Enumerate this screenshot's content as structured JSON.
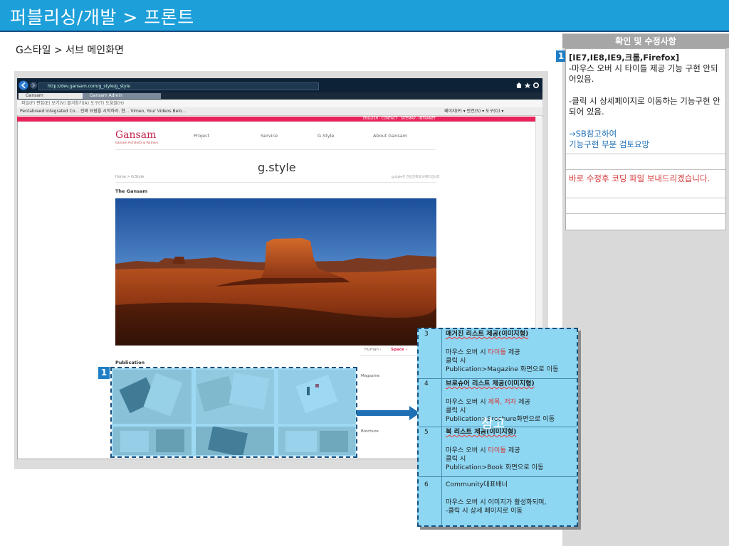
{
  "header": {
    "title": "퍼블리싱/개발 > 프론트"
  },
  "subtitle": "G스타일 > 서브 메인화면",
  "review_panel": {
    "heading": "확인 및 수정사항",
    "badge": "1",
    "browsers": "[IE7,IE8,IE9,크롬,Firefox]",
    "note1": "-마우스 오버 시 타이틀 제공 기능 구현 안되어있음.",
    "note2": "-클릭 시 상세페이지로 이동하는 기능구현 안되어 있음.",
    "note3a": "→SB참고하여",
    "note3b": "기능구현 부분 검토요망",
    "reply": "바로 수정후 코딩 파일 보내드리겠습니다."
  },
  "browser": {
    "address": "http://dev.gansam.com/g_style/g_style",
    "tab1": "Gansam",
    "tab2": "Gansam Admin",
    "menu": "파일(F)   편집(E)   보기(V)   즐겨찾기(A)   도구(T)   도움말(H)",
    "favorites": "Pentabreed Integrated Co...   진짜 요람을 시작하라. 현...   Vimeo, Your Videos Belo...",
    "toolbar_right": "페이지(P) ▾  안전(S) ▾  도구(O) ▾"
  },
  "site": {
    "toplinks": "ENGLISH · CONTACT · SITEMAP · INTRANET",
    "logo": "Gansam",
    "logo_sub": "Gansam Architects & Partners",
    "nav": [
      "Project",
      "Service",
      "G.Style",
      "About Gansam"
    ],
    "page_title": "g.style",
    "breadcrumb": "Home > G.Style",
    "crumb_right": "g.style은 간삼건축의 브랜드입니다",
    "section_title": "The Gansam",
    "tab_human": "Human ›",
    "tab_space": "Space ›",
    "publication": "Publication",
    "magazine": "Magazine",
    "brochure": "Brochure"
  },
  "grid": {
    "badge": "1"
  },
  "overlay_word": "참고",
  "notes": [
    {
      "num": "3",
      "title": "매거진 리스트 제공(이미지형)",
      "l1a": "마우스 오버 시 ",
      "l1b": "타이틀",
      "l1c": " 제공",
      "l2": "클릭 시",
      "l3": "Publication>Magazine 화면으로 이동"
    },
    {
      "num": "4",
      "title": "브로슈어 리스트 제공(이미지형)",
      "l1a": "마우스 오버 시 ",
      "l1b": "제목, 저자",
      "l1c": " 제공",
      "l2": "클릭 시",
      "l3": "Publication>Brochure화면으로 이동"
    },
    {
      "num": "5",
      "title": "북 리스트 제공(이미지형)",
      "l1a": "마우스 오버 시 ",
      "l1b": "타이틀",
      "l1c": " 제공",
      "l2": "클릭 시",
      "l3": "Publication>Book 화면으로 이동"
    },
    {
      "num": "6",
      "title": "Community대표배너",
      "l2": "마우스 오버 시 이미지가 활성화되며,",
      "l3": "-클릭 시 상세 페이지로 이동"
    }
  ],
  "colors": {
    "header": "#1d9fd9",
    "accent_pink": "#e6245a",
    "badge": "#1f7fc6",
    "note_bg": "#8dd7f3",
    "reply_red": "#d43a3a",
    "link_blue": "#1f6fb5"
  }
}
